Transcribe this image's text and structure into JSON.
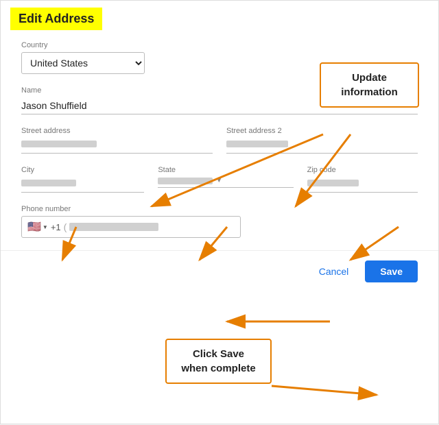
{
  "page": {
    "title": "Edit Address"
  },
  "form": {
    "country_label": "Country",
    "country_value": "United States",
    "name_label": "Name",
    "name_value": "Jason Shuffield",
    "street1_label": "Street address",
    "street1_placeholder": "",
    "street2_label": "Street address 2",
    "street2_placeholder": "",
    "city_label": "City",
    "city_placeholder": "",
    "state_label": "State",
    "state_placeholder": "",
    "zip_label": "Zip code",
    "zip_placeholder": "",
    "phone_label": "Phone number",
    "phone_placeholder": "",
    "phone_country_code": "+1"
  },
  "callouts": {
    "update": "Update\ninformation",
    "save": "Click Save\nwhen complete"
  },
  "footer": {
    "cancel_label": "Cancel",
    "save_label": "Save"
  }
}
